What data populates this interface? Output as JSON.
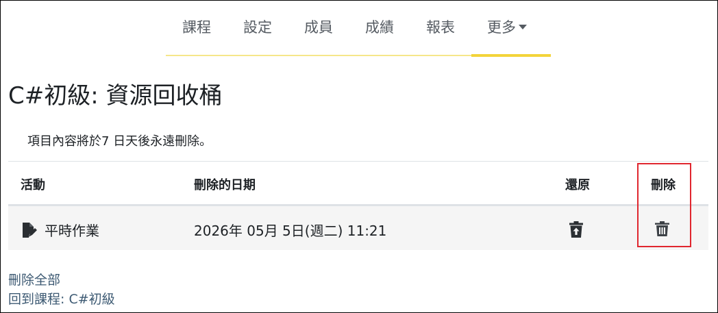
{
  "nav": {
    "items": [
      {
        "label": "課程"
      },
      {
        "label": "設定"
      },
      {
        "label": "成員"
      },
      {
        "label": "成績"
      },
      {
        "label": "報表"
      },
      {
        "label": "更多"
      }
    ],
    "active_index": 5
  },
  "page": {
    "title": "C#初級: 資源回收桶",
    "notice": "項目內容將於7 日天後永遠刪除。"
  },
  "table": {
    "headers": {
      "activity": "活動",
      "deleted_date": "刪除的日期",
      "restore": "還原",
      "delete": "刪除"
    },
    "rows": [
      {
        "activity": "平時作業",
        "activity_icon": "assignment-icon",
        "deleted_date": "2026年 05月 5日(週二) 11:21",
        "restore_icon": "restore-trash-icon",
        "delete_icon": "trash-icon"
      }
    ]
  },
  "links": {
    "delete_all": "刪除全部",
    "back_to_course": "回到課程: C#初級"
  },
  "colors": {
    "nav_accent": "#f3d43a",
    "highlight": "#e0262e",
    "link": "#3d5a73",
    "row_bg": "#f5f5f5"
  }
}
